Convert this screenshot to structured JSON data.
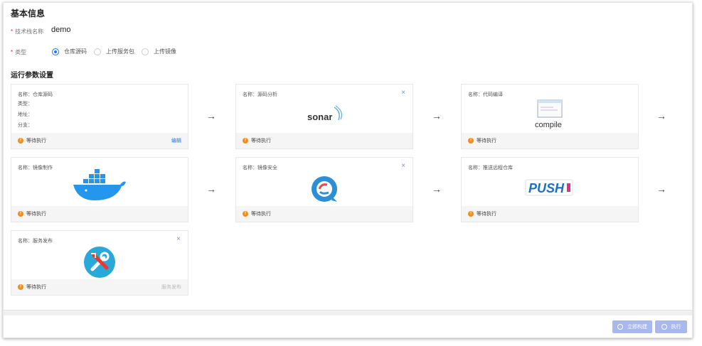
{
  "basic": {
    "section_title": "基本信息",
    "name_label": "技术栈名称",
    "name_value": "demo",
    "type_label": "类型",
    "type_options": [
      "仓库源码",
      "上传服务包",
      "上传镜像"
    ],
    "type_selected_index": 0
  },
  "run": {
    "section_title": "运行参数设置"
  },
  "cards": [
    {
      "name": "名称：仓库源码",
      "meta": [
        "类型：",
        "地址：",
        "分支："
      ],
      "status": "等待执行",
      "link": "编辑",
      "logo": "source-repo",
      "closable": false
    },
    {
      "name": "名称：源码分析",
      "meta": [],
      "status": "等待执行",
      "link": "",
      "logo": "sonar",
      "closable": true
    },
    {
      "name": "名称：代码编译",
      "meta": [],
      "status": "等待执行",
      "link": "",
      "logo": "compile",
      "closable": false
    },
    {
      "name": "名称：镜像制作",
      "meta": [],
      "status": "等待执行",
      "link": "",
      "logo": "docker",
      "closable": false
    },
    {
      "name": "名称：镜像安全",
      "meta": [],
      "status": "等待执行",
      "link": "",
      "logo": "security",
      "closable": true
    },
    {
      "name": "名称：推送远程仓库",
      "meta": [],
      "status": "等待执行",
      "link": "",
      "logo": "push",
      "closable": false
    },
    {
      "name": "名称：服务发布",
      "meta": [],
      "status": "等待执行",
      "link": "服务发布",
      "logo": "tools",
      "closable": true
    }
  ],
  "logos": {
    "sonar_text": "sonar",
    "compile_text": "compile",
    "push_text": "PUSH"
  },
  "close_glyph": "×",
  "arrow_glyph": "→",
  "status_glyph": "!",
  "actions": {
    "save_label": "立即构建",
    "run_label": "执行"
  },
  "colors": {
    "primary": "#1677ff",
    "warning": "#fa8c16",
    "button": "#a9b9f0"
  }
}
